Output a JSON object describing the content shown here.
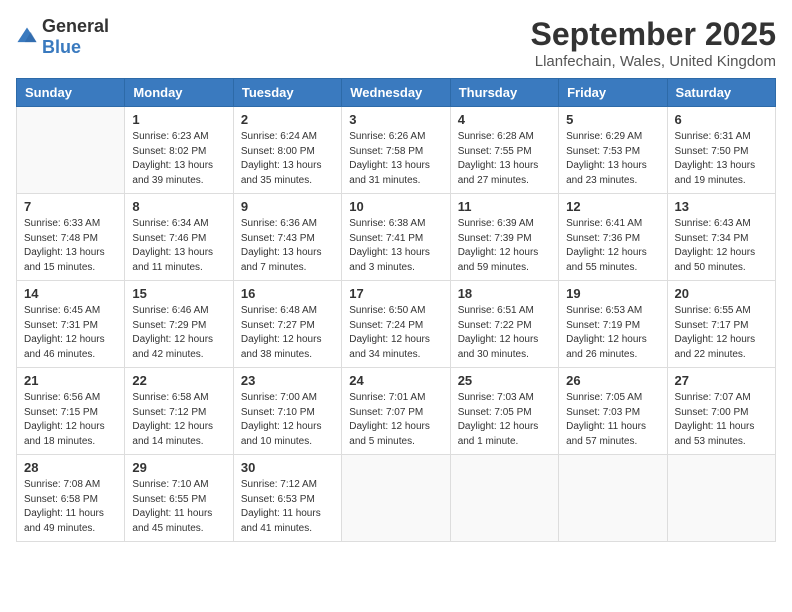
{
  "header": {
    "logo_general": "General",
    "logo_blue": "Blue",
    "month": "September 2025",
    "location": "Llanfechain, Wales, United Kingdom"
  },
  "columns": [
    "Sunday",
    "Monday",
    "Tuesday",
    "Wednesday",
    "Thursday",
    "Friday",
    "Saturday"
  ],
  "weeks": [
    [
      {
        "day": "",
        "empty": true
      },
      {
        "day": "1",
        "sunrise": "Sunrise: 6:23 AM",
        "sunset": "Sunset: 8:02 PM",
        "daylight": "Daylight: 13 hours and 39 minutes."
      },
      {
        "day": "2",
        "sunrise": "Sunrise: 6:24 AM",
        "sunset": "Sunset: 8:00 PM",
        "daylight": "Daylight: 13 hours and 35 minutes."
      },
      {
        "day": "3",
        "sunrise": "Sunrise: 6:26 AM",
        "sunset": "Sunset: 7:58 PM",
        "daylight": "Daylight: 13 hours and 31 minutes."
      },
      {
        "day": "4",
        "sunrise": "Sunrise: 6:28 AM",
        "sunset": "Sunset: 7:55 PM",
        "daylight": "Daylight: 13 hours and 27 minutes."
      },
      {
        "day": "5",
        "sunrise": "Sunrise: 6:29 AM",
        "sunset": "Sunset: 7:53 PM",
        "daylight": "Daylight: 13 hours and 23 minutes."
      },
      {
        "day": "6",
        "sunrise": "Sunrise: 6:31 AM",
        "sunset": "Sunset: 7:50 PM",
        "daylight": "Daylight: 13 hours and 19 minutes."
      }
    ],
    [
      {
        "day": "7",
        "sunrise": "Sunrise: 6:33 AM",
        "sunset": "Sunset: 7:48 PM",
        "daylight": "Daylight: 13 hours and 15 minutes."
      },
      {
        "day": "8",
        "sunrise": "Sunrise: 6:34 AM",
        "sunset": "Sunset: 7:46 PM",
        "daylight": "Daylight: 13 hours and 11 minutes."
      },
      {
        "day": "9",
        "sunrise": "Sunrise: 6:36 AM",
        "sunset": "Sunset: 7:43 PM",
        "daylight": "Daylight: 13 hours and 7 minutes."
      },
      {
        "day": "10",
        "sunrise": "Sunrise: 6:38 AM",
        "sunset": "Sunset: 7:41 PM",
        "daylight": "Daylight: 13 hours and 3 minutes."
      },
      {
        "day": "11",
        "sunrise": "Sunrise: 6:39 AM",
        "sunset": "Sunset: 7:39 PM",
        "daylight": "Daylight: 12 hours and 59 minutes."
      },
      {
        "day": "12",
        "sunrise": "Sunrise: 6:41 AM",
        "sunset": "Sunset: 7:36 PM",
        "daylight": "Daylight: 12 hours and 55 minutes."
      },
      {
        "day": "13",
        "sunrise": "Sunrise: 6:43 AM",
        "sunset": "Sunset: 7:34 PM",
        "daylight": "Daylight: 12 hours and 50 minutes."
      }
    ],
    [
      {
        "day": "14",
        "sunrise": "Sunrise: 6:45 AM",
        "sunset": "Sunset: 7:31 PM",
        "daylight": "Daylight: 12 hours and 46 minutes."
      },
      {
        "day": "15",
        "sunrise": "Sunrise: 6:46 AM",
        "sunset": "Sunset: 7:29 PM",
        "daylight": "Daylight: 12 hours and 42 minutes."
      },
      {
        "day": "16",
        "sunrise": "Sunrise: 6:48 AM",
        "sunset": "Sunset: 7:27 PM",
        "daylight": "Daylight: 12 hours and 38 minutes."
      },
      {
        "day": "17",
        "sunrise": "Sunrise: 6:50 AM",
        "sunset": "Sunset: 7:24 PM",
        "daylight": "Daylight: 12 hours and 34 minutes."
      },
      {
        "day": "18",
        "sunrise": "Sunrise: 6:51 AM",
        "sunset": "Sunset: 7:22 PM",
        "daylight": "Daylight: 12 hours and 30 minutes."
      },
      {
        "day": "19",
        "sunrise": "Sunrise: 6:53 AM",
        "sunset": "Sunset: 7:19 PM",
        "daylight": "Daylight: 12 hours and 26 minutes."
      },
      {
        "day": "20",
        "sunrise": "Sunrise: 6:55 AM",
        "sunset": "Sunset: 7:17 PM",
        "daylight": "Daylight: 12 hours and 22 minutes."
      }
    ],
    [
      {
        "day": "21",
        "sunrise": "Sunrise: 6:56 AM",
        "sunset": "Sunset: 7:15 PM",
        "daylight": "Daylight: 12 hours and 18 minutes."
      },
      {
        "day": "22",
        "sunrise": "Sunrise: 6:58 AM",
        "sunset": "Sunset: 7:12 PM",
        "daylight": "Daylight: 12 hours and 14 minutes."
      },
      {
        "day": "23",
        "sunrise": "Sunrise: 7:00 AM",
        "sunset": "Sunset: 7:10 PM",
        "daylight": "Daylight: 12 hours and 10 minutes."
      },
      {
        "day": "24",
        "sunrise": "Sunrise: 7:01 AM",
        "sunset": "Sunset: 7:07 PM",
        "daylight": "Daylight: 12 hours and 5 minutes."
      },
      {
        "day": "25",
        "sunrise": "Sunrise: 7:03 AM",
        "sunset": "Sunset: 7:05 PM",
        "daylight": "Daylight: 12 hours and 1 minute."
      },
      {
        "day": "26",
        "sunrise": "Sunrise: 7:05 AM",
        "sunset": "Sunset: 7:03 PM",
        "daylight": "Daylight: 11 hours and 57 minutes."
      },
      {
        "day": "27",
        "sunrise": "Sunrise: 7:07 AM",
        "sunset": "Sunset: 7:00 PM",
        "daylight": "Daylight: 11 hours and 53 minutes."
      }
    ],
    [
      {
        "day": "28",
        "sunrise": "Sunrise: 7:08 AM",
        "sunset": "Sunset: 6:58 PM",
        "daylight": "Daylight: 11 hours and 49 minutes."
      },
      {
        "day": "29",
        "sunrise": "Sunrise: 7:10 AM",
        "sunset": "Sunset: 6:55 PM",
        "daylight": "Daylight: 11 hours and 45 minutes."
      },
      {
        "day": "30",
        "sunrise": "Sunrise: 7:12 AM",
        "sunset": "Sunset: 6:53 PM",
        "daylight": "Daylight: 11 hours and 41 minutes."
      },
      {
        "day": "",
        "empty": true
      },
      {
        "day": "",
        "empty": true
      },
      {
        "day": "",
        "empty": true
      },
      {
        "day": "",
        "empty": true
      }
    ]
  ]
}
